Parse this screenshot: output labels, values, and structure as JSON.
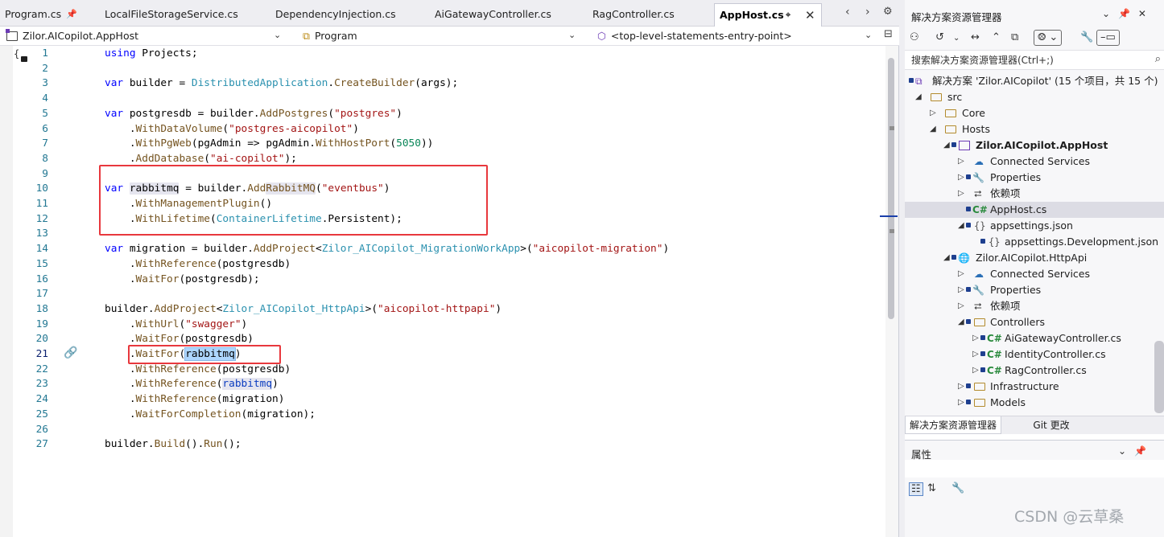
{
  "editor": {
    "tabs": [
      {
        "label": "Program.cs",
        "pinned": true
      },
      {
        "label": "LocalFileStorageService.cs"
      },
      {
        "label": "DependencyInjection.cs"
      },
      {
        "label": "AiGatewayController.cs"
      },
      {
        "label": "RagController.cs"
      },
      {
        "label": "AppHost.cs",
        "active": true,
        "pinned": true
      }
    ],
    "nav": {
      "project": "Zilor.AICopilot.AppHost",
      "class": "Program",
      "member": "<top-level-statements-entry-point>"
    },
    "outline_glyph": "{",
    "line_numbers": [
      "1",
      "2",
      "3",
      "4",
      "5",
      "6",
      "7",
      "8",
      "9",
      "10",
      "11",
      "12",
      "13",
      "14",
      "15",
      "16",
      "17",
      "18",
      "19",
      "20",
      "21",
      "22",
      "23",
      "24",
      "25",
      "26",
      "27"
    ],
    "current_line": "21"
  },
  "solution_explorer": {
    "title": "解决方案资源管理器",
    "search_placeholder": "搜索解决方案资源管理器(Ctrl+;)",
    "tree": [
      {
        "label": "解决方案 'Zilor.AICopilot' (15 个项目，共 15 个)"
      },
      {
        "label": "src"
      },
      {
        "label": "Core"
      },
      {
        "label": "Hosts"
      },
      {
        "label": "Zilor.AICopilot.AppHost",
        "bold": true
      },
      {
        "label": "Connected Services"
      },
      {
        "label": "Properties"
      },
      {
        "label": "依赖项"
      },
      {
        "label": "AppHost.cs",
        "selected": true
      },
      {
        "label": "appsettings.json"
      },
      {
        "label": "appsettings.Development.json"
      },
      {
        "label": "Zilor.AICopilot.HttpApi"
      },
      {
        "label": "Connected Services"
      },
      {
        "label": "Properties"
      },
      {
        "label": "依赖项"
      },
      {
        "label": "Controllers"
      },
      {
        "label": "AiGatewayController.cs"
      },
      {
        "label": "IdentityController.cs"
      },
      {
        "label": "RagController.cs"
      },
      {
        "label": "Infrastructure"
      },
      {
        "label": "Models"
      }
    ],
    "bottom_tabs": [
      "解决方案资源管理器",
      "Git 更改"
    ]
  },
  "properties": {
    "title": "属性"
  },
  "watermark": "CSDN @云草桑",
  "colors": {
    "keyword": "#0000ff",
    "type": "#2b91af",
    "string": "#a31515",
    "method": "#74531f",
    "highlight_box": "#e8383d",
    "selection": "#add6ff"
  }
}
